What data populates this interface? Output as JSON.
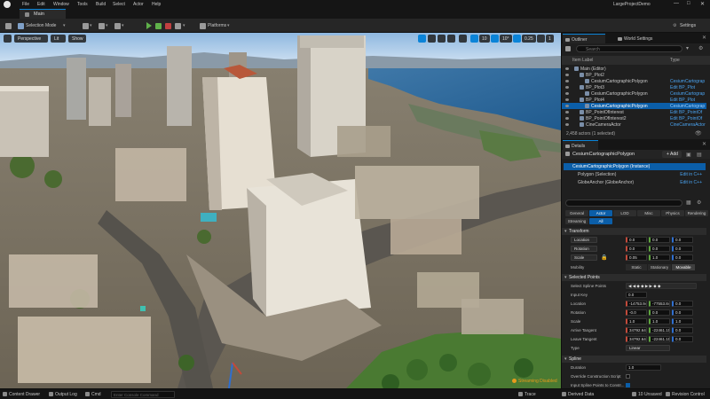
{
  "menubar": {
    "items": [
      "File",
      "Edit",
      "Window",
      "Tools",
      "Build",
      "Select",
      "Actor",
      "Help"
    ],
    "project": "LargeProjectDemo"
  },
  "tab": {
    "label": "Main"
  },
  "toolbar": {
    "selection_mode": "Selection Mode",
    "platforms": "Platforms",
    "settings": "Settings"
  },
  "viewport": {
    "perspective": "Perspective",
    "lit": "Lit",
    "show": "Show",
    "grid_snap": "10",
    "rot_snap": "10°",
    "scale_snap": "0.25",
    "camera_speed": "1",
    "streaming_status": "Streaming Disabled"
  },
  "outliner": {
    "tab_label": "Outliner",
    "world_settings_label": "World Settings",
    "search_placeholder": "Search",
    "col_item_label": "Item Label",
    "col_type": "Type",
    "rows": [
      {
        "name": "Main (Editor)",
        "type": "",
        "indent": 0,
        "selected": false
      },
      {
        "name": "BP_Plot2",
        "type": "",
        "indent": 1,
        "selected": false
      },
      {
        "name": "CesiumCartographicPolygon",
        "type": "CesiumCartograp",
        "indent": 2,
        "selected": false
      },
      {
        "name": "BP_Plot3",
        "type": "Edit BP_Plot",
        "indent": 1,
        "selected": false
      },
      {
        "name": "CesiumCartographicPolygon",
        "type": "CesiumCartograp",
        "indent": 2,
        "selected": false
      },
      {
        "name": "BP_Plot4",
        "type": "Edit BP_Plot",
        "indent": 1,
        "selected": false
      },
      {
        "name": "CesiumCartographicPolygon",
        "type": "CesiumCartograp",
        "indent": 2,
        "selected": true
      },
      {
        "name": "BP_PointOfInterest",
        "type": "Edit BP_PointOf",
        "indent": 1,
        "selected": false
      },
      {
        "name": "BP_PointOfInterest2",
        "type": "Edit BP_PointOf",
        "indent": 1,
        "selected": false
      },
      {
        "name": "CineCameraActor",
        "type": "CineCameraActor",
        "indent": 1,
        "selected": false
      }
    ],
    "count": "2,458 actors (1 selected)"
  },
  "details": {
    "tab_label": "Details",
    "title": "CesiumCartographicPolygon",
    "add_label": "+ Add",
    "components": [
      {
        "name": "CesiumCartographicPolygon (Instance)",
        "right": "",
        "selected": true
      },
      {
        "name": "Polygon (Selection)",
        "right": "Edit in C++",
        "selected": false
      },
      {
        "name": "GlobeAnchor (GlobeAnchor)",
        "right": "Edit in C++",
        "selected": false
      }
    ],
    "categories_row1": [
      "General",
      "Actor",
      "LOD",
      "Misc",
      "Physics",
      "Rendering"
    ],
    "categories_row2": [
      "Streaming",
      "All"
    ],
    "transform_section": "Transform",
    "location_label": "Location",
    "rotation_label": "Rotation",
    "scale_label": "Scale",
    "location": [
      "0.0",
      "0.0",
      "0.0"
    ],
    "rotation": [
      "0.0",
      "0.0",
      "0.0"
    ],
    "scale": [
      "0.05",
      "1.0",
      "0.0"
    ],
    "mobility_label": "Mobility",
    "mobility_options": [
      "Static",
      "Stationary",
      "Movable"
    ],
    "selected_points_section": "Selected Points",
    "select_spline_points": "Select Spline Points",
    "input_key_label": "Input Key",
    "input_key": "0.0",
    "sp_location_label": "Location",
    "sp_location": [
      "-14753.945",
      "-77553.8463",
      "0.0"
    ],
    "sp_rotation_label": "Rotation",
    "sp_rotation": [
      "-0.0",
      "0.0",
      "0.0"
    ],
    "sp_scale_label": "Scale",
    "sp_scale": [
      "1.0",
      "1.0",
      "1.0"
    ],
    "arrive_tangent_label": "Arrive Tangent",
    "arrive_tangent": [
      "34792.6487",
      "-22461.1508",
      "0.0"
    ],
    "leave_tangent_label": "Leave Tangent",
    "leave_tangent": [
      "34792.6487",
      "-22461.1508",
      "0.0"
    ],
    "type_label": "Type",
    "type_value": "Linear",
    "spline_section": "Spline",
    "duration_label": "Duration",
    "duration": "1.0",
    "override_label": "Override Construction Script",
    "input_spline_label": "Input Spline Points to Constr..."
  },
  "statusbar": {
    "content_drawer": "Content Drawer",
    "output_log": "Output Log",
    "cmd": "Cmd",
    "cmd_placeholder": "Enter Console Command",
    "trace": "Trace",
    "derived_data": "Derived Data",
    "unsaved": "10 Unsaved",
    "revision_control": "Revision Control"
  },
  "colors": {
    "accent": "#0b84d8",
    "selection": "#0b5ea8",
    "link": "#4aa3f0",
    "warning": "#e89b1c"
  }
}
